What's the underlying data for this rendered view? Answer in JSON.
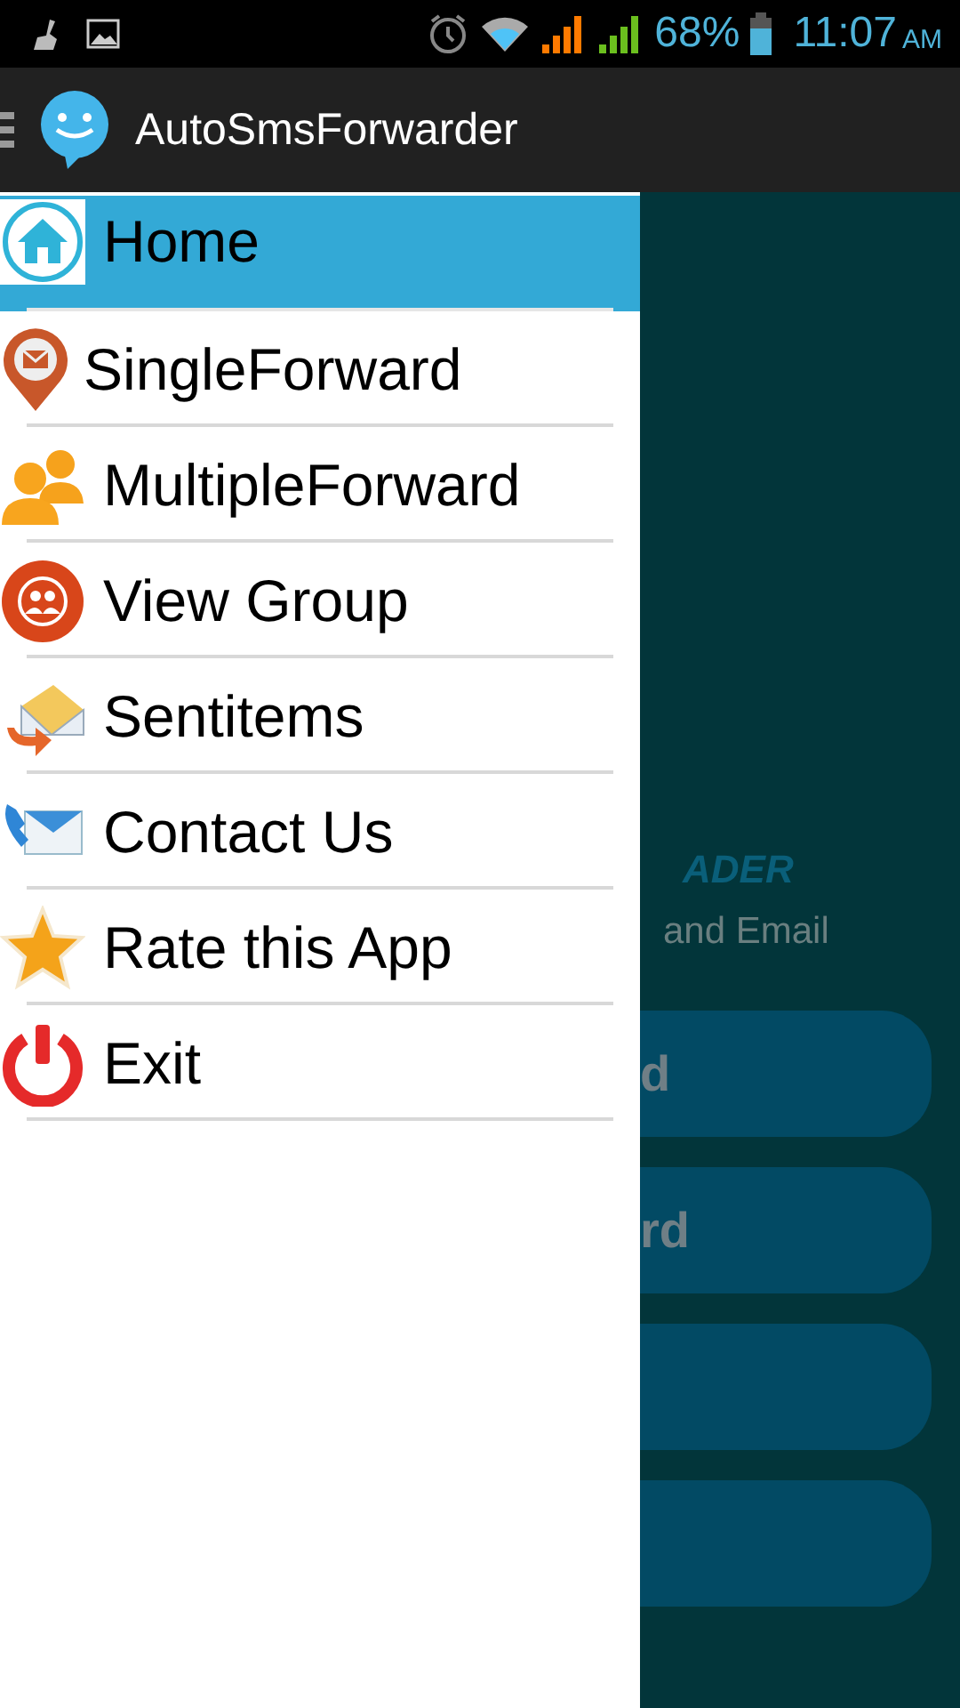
{
  "status_bar": {
    "battery": "68%",
    "time": "11:07",
    "meridiem": "AM"
  },
  "app_bar": {
    "title": "AutoSmsForwarder"
  },
  "drawer": {
    "items": [
      {
        "label": "Home",
        "kind": "home",
        "selected": true
      },
      {
        "label": "SingleForward",
        "kind": "pin",
        "selected": false
      },
      {
        "label": "MultipleForward",
        "kind": "people",
        "selected": false
      },
      {
        "label": "View Group",
        "kind": "group",
        "selected": false
      },
      {
        "label": "Sentitems",
        "kind": "mail",
        "selected": false
      },
      {
        "label": "Contact Us",
        "kind": "contact",
        "selected": false
      },
      {
        "label": "Rate this App",
        "kind": "star",
        "selected": false
      },
      {
        "label": "Exit",
        "kind": "power",
        "selected": false
      }
    ]
  },
  "background": {
    "logo": "ADER",
    "subtitle": "and Email",
    "buttons": [
      {
        "kind": "labeled",
        "label": "d"
      },
      {
        "kind": "labeled",
        "label": "rd"
      },
      {
        "kind": "blank"
      },
      {
        "kind": "blank"
      }
    ]
  }
}
